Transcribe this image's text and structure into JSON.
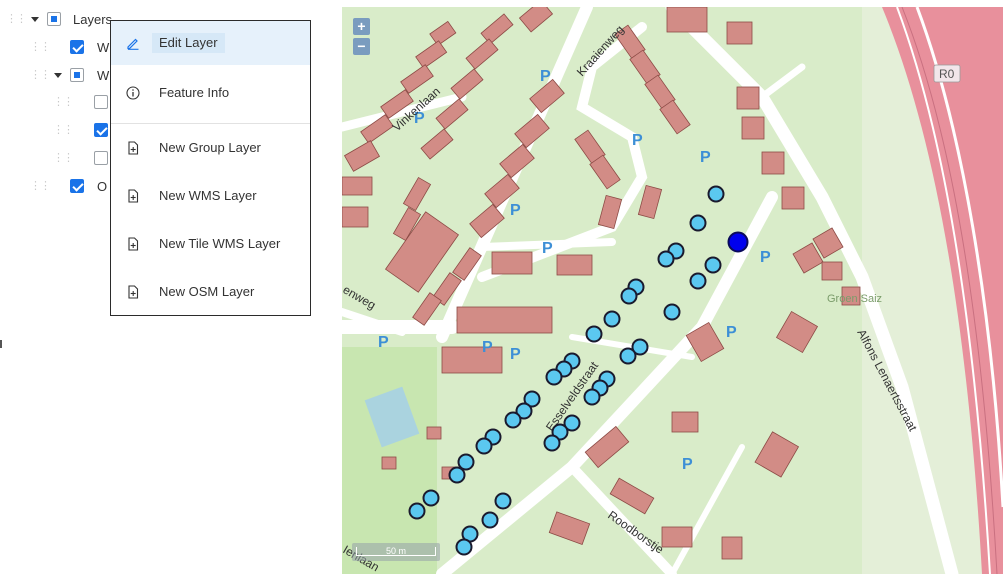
{
  "tree": {
    "root_label": "Layers",
    "rows": [
      {
        "label": "W",
        "checked": true
      },
      {
        "label": "W",
        "checked": "partial"
      },
      {
        "label": "",
        "checked": false
      },
      {
        "label": "",
        "checked": true
      },
      {
        "label": "",
        "checked": false
      },
      {
        "label": "O",
        "checked": true
      }
    ]
  },
  "context_menu": {
    "items": [
      {
        "label": "Edit Layer",
        "icon": "pencil-icon",
        "active": true
      },
      {
        "label": "Feature Info",
        "icon": "info-icon"
      },
      {
        "label": "New Group Layer",
        "icon": "file-plus-icon"
      },
      {
        "label": "New WMS Layer",
        "icon": "file-plus-icon"
      },
      {
        "label": "New Tile WMS Layer",
        "icon": "file-plus-icon"
      },
      {
        "label": "New OSM Layer",
        "icon": "file-plus-icon"
      }
    ]
  },
  "map": {
    "zoom_in": "+",
    "zoom_out": "−",
    "scale_label": "50 m",
    "street_labels": [
      "Kraaienweg",
      "Vinkenlaan",
      "Esselveldstraat",
      "Alfons Lenaertsstraat",
      "Roodborstje",
      "enweg",
      "Ienlaan",
      "Groen Saiz",
      "R0"
    ],
    "parking_symbol": "P",
    "colors": {
      "park": "#d9ecc9",
      "building": "#d28c86",
      "road": "#ffffff",
      "highway": "#e8909c",
      "marker": "#5bc8f0",
      "selected_marker": "#0000ee"
    }
  }
}
